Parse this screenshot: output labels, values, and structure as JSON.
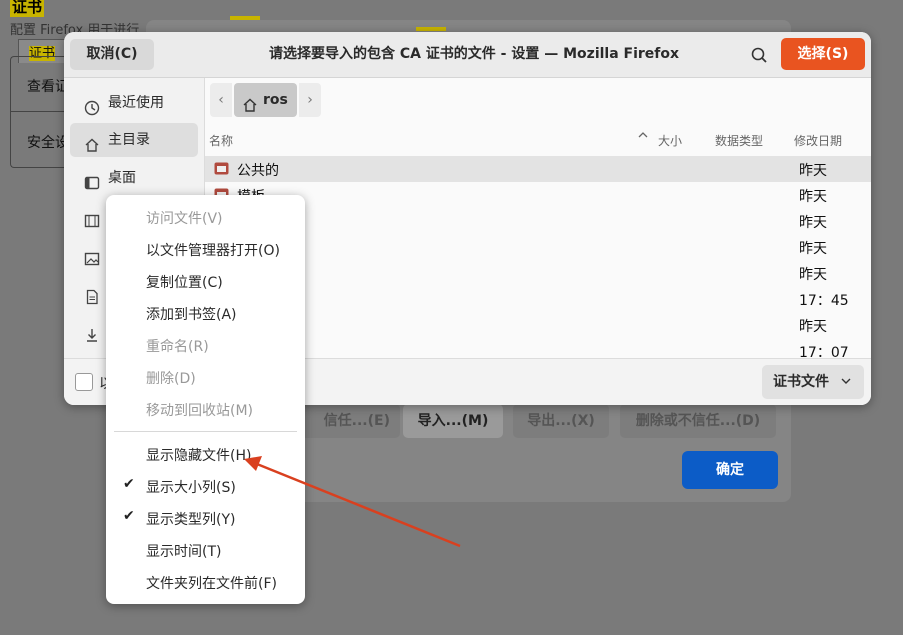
{
  "background": {
    "settings_title": "证书",
    "settings_desc": "配置 Firefox 用于进行",
    "tab_label": "证书",
    "cell1": "查看证",
    "cell2": "安全设",
    "buttons": [
      "信任...(E)",
      "导入...(M)",
      "导出...(X)",
      "删除或不信任...(D)"
    ],
    "ok_label": "确定"
  },
  "chooser": {
    "cancel_label": "取消(C)",
    "title": "请选择要导入的包含 CA 证书的文件 - 设置 — Mozilla Firefox",
    "search_icon": "search-icon",
    "select_label": "选择(S)",
    "sidebar": [
      {
        "label": "最近使用",
        "icon": "clock-icon"
      },
      {
        "label": "主目录",
        "icon": "home-icon",
        "active": true
      },
      {
        "label": "桌面",
        "icon": "desktop-icon"
      },
      {
        "label": "",
        "icon": "video-icon"
      },
      {
        "label": "",
        "icon": "picture-icon"
      },
      {
        "label": "",
        "icon": "document-icon"
      },
      {
        "label": "",
        "icon": "download-icon"
      }
    ],
    "path": {
      "crumb": "ros"
    },
    "columns": {
      "name": "名称",
      "size": "大小",
      "type": "数据类型",
      "modified": "修改日期"
    },
    "rows": [
      {
        "name": "公共的",
        "date": "昨天"
      },
      {
        "name": "模板",
        "date": "昨天"
      },
      {
        "name": "",
        "date": "昨天"
      },
      {
        "name": "",
        "date": "昨天"
      },
      {
        "name": "",
        "date": "昨天"
      },
      {
        "name": "",
        "date": "17：45"
      },
      {
        "name": "",
        "date": "昨天"
      },
      {
        "name": "",
        "date": "17：07"
      }
    ],
    "footer_label": "以",
    "filter_label": "证书文件"
  },
  "menu": {
    "items": [
      {
        "label": "访问文件(V)",
        "disabled": true
      },
      {
        "label": "以文件管理器打开(O)"
      },
      {
        "label": "复制位置(C)"
      },
      {
        "label": "添加到书签(A)"
      },
      {
        "label": "重命名(R)",
        "disabled": true
      },
      {
        "label": "删除(D)",
        "disabled": true
      },
      {
        "label": "移动到回收站(M)",
        "disabled": true
      },
      {
        "label": "显示隐藏文件(H)"
      },
      {
        "label": "显示大小列(S)",
        "checked": true
      },
      {
        "label": "显示类型列(Y)",
        "checked": true
      },
      {
        "label": "显示时间(T)"
      },
      {
        "label": "文件夹列在文件前(F)"
      }
    ]
  },
  "annotation": {
    "color": "#d9401f"
  }
}
